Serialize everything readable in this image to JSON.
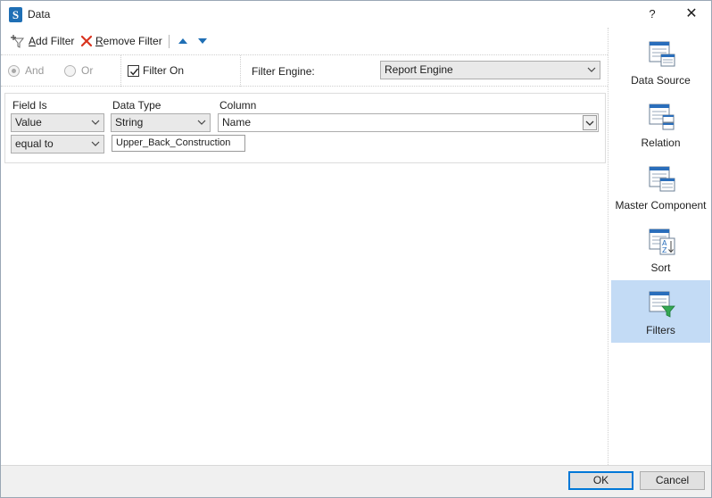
{
  "window": {
    "title": "Data",
    "help_label": "?",
    "close_label": "✕"
  },
  "toolbar": {
    "add_filter_label": "Add Filter",
    "add_filter_hotkey": "A",
    "add_filter_rest": "dd Filter",
    "remove_filter_hotkey": "R",
    "remove_filter_rest": "emove Filter",
    "move_up_icon": "arrow-up-icon",
    "move_down_icon": "arrow-down-icon"
  },
  "logic": {
    "and_label": "And",
    "or_label": "Or",
    "and_selected": true,
    "filter_on_label": "Filter On",
    "filter_on_checked": true,
    "filter_engine_label": "Filter Engine:",
    "filter_engine_value": "Report Engine"
  },
  "filter": {
    "field_is_label": "Field Is",
    "data_type_label": "Data Type",
    "column_label": "Column",
    "field_is_value": "Value",
    "data_type_value": "String",
    "column_value": "Name",
    "condition_value": "equal to",
    "condition_text": "Upper_Back_Construction"
  },
  "sidebar": {
    "items": [
      {
        "label": "Data Source",
        "icon": "data-source-icon",
        "active": false
      },
      {
        "label": "Relation",
        "icon": "relation-icon",
        "active": false
      },
      {
        "label": "Master Component",
        "icon": "master-component-icon",
        "active": false
      },
      {
        "label": "Sort",
        "icon": "sort-icon",
        "active": false
      },
      {
        "label": "Filters",
        "icon": "filters-icon",
        "active": true
      }
    ]
  },
  "footer": {
    "ok_label": "OK",
    "cancel_label": "Cancel"
  },
  "colors": {
    "accent": "#1f6fb5",
    "active_bg": "#c3dbf5",
    "remove_red": "#d9341f",
    "default_button_border": "#0078d7"
  }
}
